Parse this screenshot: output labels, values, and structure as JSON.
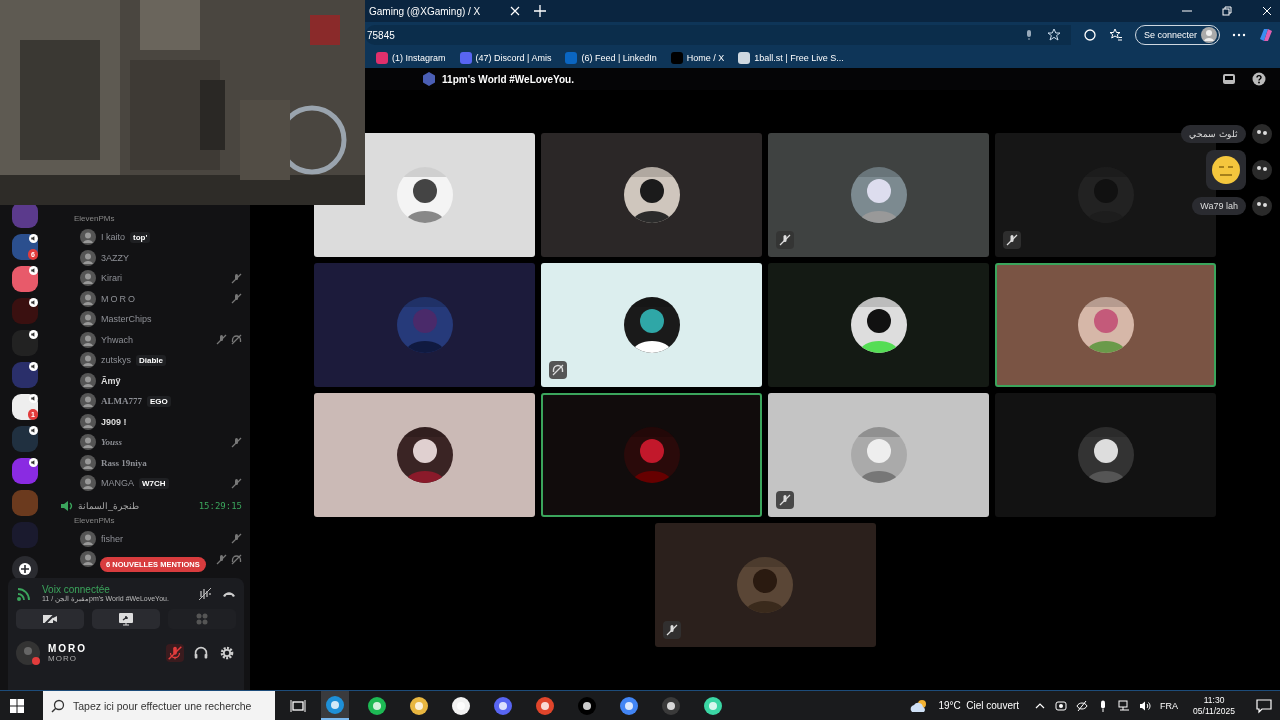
{
  "browser": {
    "tab": {
      "title": "Gaming (@XGaming) / X"
    },
    "address": "75845",
    "sign_in": "Se connecter",
    "bookmarks": [
      {
        "label": "(1) Instagram",
        "color": "#e1306c"
      },
      {
        "label": "(47) Discord | Amis",
        "color": "#5865f2"
      },
      {
        "label": "(6) Feed | LinkedIn",
        "color": "#0a66c2"
      },
      {
        "label": "Home / X",
        "color": "#000000"
      },
      {
        "label": "1ball.st | Free Live S...",
        "color": "#cfd8e0"
      }
    ]
  },
  "discord": {
    "title": "11pm's World #WeLoveYou.",
    "servers": [
      {
        "color": "#5b3a8c",
        "voice": false
      },
      {
        "color": "#2b4f8e",
        "badge": "6",
        "voice": true
      },
      {
        "color": "#e85a6a",
        "voice": true
      },
      {
        "color": "#3a1010",
        "voice": true
      },
      {
        "color": "#222222",
        "voice": true
      },
      {
        "color": "#2a2f6a",
        "voice": true
      },
      {
        "color": "#eeeeee",
        "badge": "1",
        "voice": true
      },
      {
        "color": "#203040",
        "voice": true
      },
      {
        "color": "#8a2be2",
        "voice": true
      },
      {
        "color": "#6b3a1e",
        "voice": false
      },
      {
        "color": "#1a1a2e",
        "voice": false
      }
    ],
    "channels": [
      {
        "subtitle": "ElevenPMs",
        "members": [
          {
            "name": "I kaito",
            "tag": "top'",
            "kind": "plain",
            "muted": false,
            "deafened": false
          },
          {
            "name": "3AZZY",
            "kind": "plain",
            "muted": false,
            "deafened": false
          },
          {
            "name": "Kirari",
            "kind": "plain",
            "muted": true,
            "deafened": false
          },
          {
            "name": "MORO",
            "kind": "spaced",
            "muted": true,
            "deafened": false
          },
          {
            "name": "MasterChips",
            "kind": "plain",
            "muted": false,
            "deafened": false
          },
          {
            "name": "Yhwach",
            "kind": "plain",
            "muted": true,
            "deafened": true
          },
          {
            "name": "zutskys",
            "tag": "Diable",
            "kind": "plain",
            "muted": false,
            "deafened": false
          },
          {
            "name": "Ãmÿ",
            "kind": "bold",
            "muted": false,
            "deafened": false
          },
          {
            "name": "ALMA777",
            "tag": "EGO",
            "kind": "serif",
            "muted": false,
            "deafened": false
          },
          {
            "name": "J909 !",
            "kind": "bold",
            "muted": false,
            "deafened": false
          },
          {
            "name": "Youss",
            "kind": "italic",
            "muted": true,
            "deafened": false
          },
          {
            "name": "Rass 19niya",
            "kind": "serif",
            "muted": false,
            "deafened": false
          },
          {
            "name": "MANGA",
            "tag": "W7CH",
            "kind": "plain",
            "muted": true,
            "deafened": false
          }
        ]
      },
      {
        "name": "طنجرة_السمانة",
        "time": "15:29:15",
        "subtitle": "ElevenPMs",
        "members": [
          {
            "name": "fisher",
            "kind": "plain",
            "muted": true,
            "deafened": false
          },
          {
            "muted": true,
            "deafened": true
          }
        ]
      }
    ],
    "mentions": "6 NOUVELLES MENTIONS",
    "voice": {
      "status": "Voix connectée",
      "channel": "مقبرة الجن / 11pm's World #WeLoveYou."
    },
    "user": {
      "name": "MORO",
      "sub": "MORO",
      "muted": true
    },
    "tiles": [
      {
        "color": "#dcdcdc",
        "muted": false,
        "deafened": false,
        "speaking": false
      },
      {
        "color": "#2b2727",
        "muted": false,
        "deafened": false,
        "speaking": false
      },
      {
        "color": "#3f4241",
        "muted": true,
        "deafened": false,
        "speaking": false
      },
      {
        "color": "#161616",
        "muted": true,
        "deafened": false,
        "speaking": false
      },
      {
        "color": "#1c1b3b",
        "muted": false,
        "deafened": false,
        "speaking": false
      },
      {
        "color": "#dceeee",
        "muted": false,
        "deafened": true,
        "speaking": false
      },
      {
        "color": "#141a14",
        "muted": false,
        "deafened": false,
        "speaking": false
      },
      {
        "color": "#7a5444",
        "muted": false,
        "deafened": false,
        "speaking": true
      },
      {
        "color": "#cbbab6",
        "muted": false,
        "deafened": false,
        "speaking": false
      },
      {
        "color": "#110c0c",
        "muted": false,
        "deafened": false,
        "speaking": true
      },
      {
        "color": "#c4c4c4",
        "muted": true,
        "deafened": false,
        "speaking": false
      },
      {
        "color": "#121212",
        "muted": false,
        "deafened": false,
        "speaking": false
      },
      {
        "color": "#2b201c",
        "muted": true,
        "deafened": false,
        "speaking": false
      }
    ],
    "reactions": [
      {
        "kind": "text",
        "label": "ثلوث سمحي"
      },
      {
        "kind": "emoji"
      },
      {
        "kind": "text",
        "label": "Wa79 lah"
      }
    ]
  },
  "taskbar": {
    "search_placeholder": "Tapez ici pour effectuer une recherche",
    "weather": "19°C  Ciel couvert",
    "lang": "FRA",
    "time": "11:30",
    "date": "05/11/2025",
    "apps": [
      {
        "color": "#1e90d8",
        "selected": true
      },
      {
        "color": "#1db954",
        "selected": false
      },
      {
        "color": "#e8b640",
        "selected": false
      },
      {
        "color": "#f2f2f2",
        "selected": false
      },
      {
        "color": "#5865f2",
        "selected": false
      },
      {
        "color": "#e0452b",
        "selected": false
      },
      {
        "color": "#000000",
        "selected": false
      },
      {
        "color": "#4285f4",
        "selected": false
      },
      {
        "color": "#3a3a3a",
        "selected": false
      },
      {
        "color": "#3bd6a4",
        "selected": false
      }
    ]
  }
}
